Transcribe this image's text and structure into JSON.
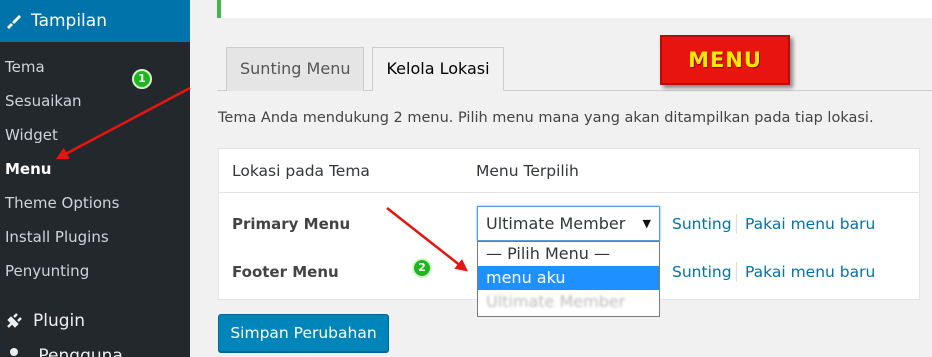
{
  "sidebar": {
    "section_title": "Tampilan",
    "items": [
      {
        "label": "Tema"
      },
      {
        "label": "Sesuaikan"
      },
      {
        "label": "Widget"
      },
      {
        "label": "Menu"
      },
      {
        "label": "Theme Options"
      },
      {
        "label": "Install Plugins"
      },
      {
        "label": "Penyunting"
      }
    ],
    "plugin_label": "Plugin",
    "next_label": "Pengguna"
  },
  "tabs": [
    {
      "label": "Sunting Menu"
    },
    {
      "label": "Kelola Lokasi"
    }
  ],
  "badge": {
    "label": "MENU"
  },
  "description": "Tema Anda mendukung 2 menu. Pilih menu mana yang akan ditampilkan pada tiap lokasi.",
  "table": {
    "col_location": "Lokasi pada Tema",
    "col_selected": "Menu Terpilih",
    "rows": [
      {
        "label": "Primary Menu",
        "selected": "Ultimate Member",
        "edit": "Sunting",
        "new": "Pakai menu baru"
      },
      {
        "label": "Footer Menu",
        "edit": "Sunting",
        "new": "Pakai menu baru"
      }
    ]
  },
  "dropdown_options": [
    "— Pilih Menu —",
    "menu aku",
    "Ultimate Member"
  ],
  "save_button": "Simpan Perubahan",
  "annotations": [
    "1",
    "2"
  ],
  "colors": {
    "accent": "#0073aa",
    "arrow": "#e8140f",
    "highlight": "#1e90ff"
  }
}
